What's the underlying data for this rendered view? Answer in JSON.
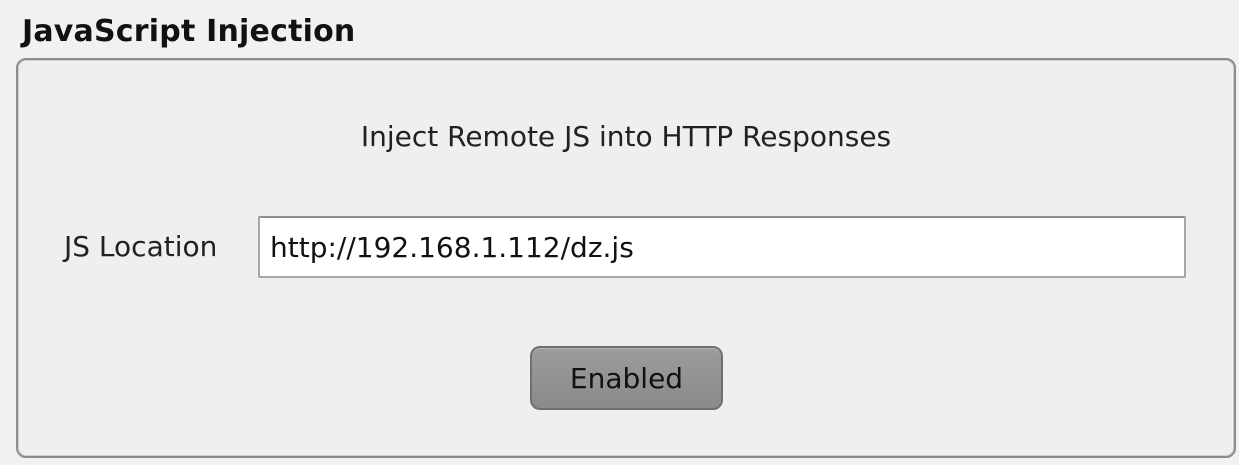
{
  "section": {
    "title": "JavaScript Injection"
  },
  "panel": {
    "subtitle": "Inject Remote JS into HTTP Responses",
    "js_location": {
      "label": "JS Location",
      "value": "http://192.168.1.112/dz.js"
    },
    "toggle_button": {
      "label": "Enabled"
    }
  }
}
